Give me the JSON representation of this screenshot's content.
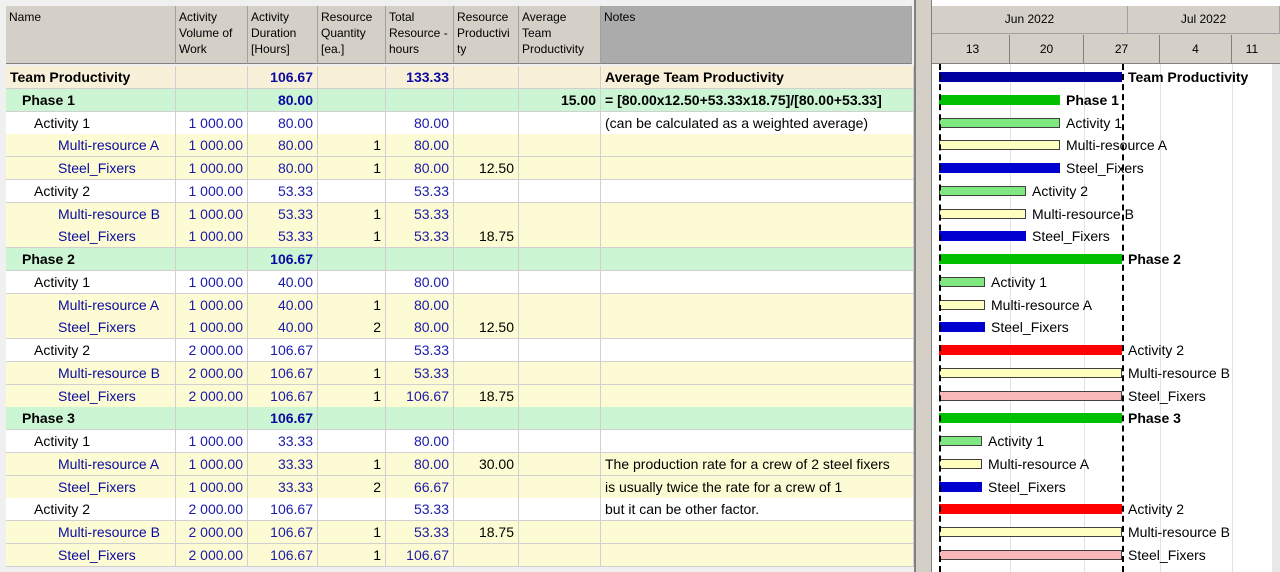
{
  "columns": {
    "name": "Name",
    "volume": "Activity Volume of Work",
    "duration": "Activity Duration [Hours]",
    "quantity": "Resource Quantity [ea.]",
    "total_hours": "Total Resource -hours",
    "productivity": "Resource Productivi ty",
    "avg_productivity": "Average Team Productivity",
    "notes": "Notes"
  },
  "rows": [
    {
      "type": "team",
      "name": "Team Productivity",
      "volume": "",
      "duration": "106.67",
      "quantity": "",
      "total": "133.33",
      "prod": "",
      "avg": "",
      "notes": "Average Team Productivity"
    },
    {
      "type": "phase",
      "name": "Phase 1",
      "volume": "",
      "duration": "80.00",
      "quantity": "",
      "total": "",
      "prod": "",
      "avg": "15.00",
      "notes": "= [80.00x12.50+53.33x18.75]/[80.00+53.33]"
    },
    {
      "type": "act",
      "name": "Activity 1",
      "volume": "1 000.00",
      "duration": "80.00",
      "quantity": "",
      "total": "80.00",
      "prod": "",
      "avg": "",
      "notes": "(can be calculated as a weighted average)"
    },
    {
      "type": "res",
      "name": "Multi-resource A",
      "volume": "1 000.00",
      "duration": "80.00",
      "quantity": "1",
      "total": "80.00",
      "prod": "",
      "avg": "",
      "notes": ""
    },
    {
      "type": "res",
      "name": "Steel_Fixers",
      "volume": "1 000.00",
      "duration": "80.00",
      "quantity": "1",
      "total": "80.00",
      "prod": "12.50",
      "avg": "",
      "notes": ""
    },
    {
      "type": "act",
      "name": "Activity 2",
      "volume": "1 000.00",
      "duration": "53.33",
      "quantity": "",
      "total": "53.33",
      "prod": "",
      "avg": "",
      "notes": ""
    },
    {
      "type": "res",
      "name": "Multi-resource B",
      "volume": "1 000.00",
      "duration": "53.33",
      "quantity": "1",
      "total": "53.33",
      "prod": "",
      "avg": "",
      "notes": ""
    },
    {
      "type": "res",
      "name": "Steel_Fixers",
      "volume": "1 000.00",
      "duration": "53.33",
      "quantity": "1",
      "total": "53.33",
      "prod": "18.75",
      "avg": "",
      "notes": ""
    },
    {
      "type": "phase",
      "name": "Phase 2",
      "volume": "",
      "duration": "106.67",
      "quantity": "",
      "total": "",
      "prod": "",
      "avg": "",
      "notes": ""
    },
    {
      "type": "act",
      "name": "Activity 1",
      "volume": "1 000.00",
      "duration": "40.00",
      "quantity": "",
      "total": "80.00",
      "prod": "",
      "avg": "",
      "notes": ""
    },
    {
      "type": "res",
      "name": "Multi-resource A",
      "volume": "1 000.00",
      "duration": "40.00",
      "quantity": "1",
      "total": "80.00",
      "prod": "",
      "avg": "",
      "notes": ""
    },
    {
      "type": "res",
      "name": "Steel_Fixers",
      "volume": "1 000.00",
      "duration": "40.00",
      "quantity": "2",
      "total": "80.00",
      "prod": "12.50",
      "avg": "",
      "notes": ""
    },
    {
      "type": "act",
      "name": "Activity 2",
      "volume": "2 000.00",
      "duration": "106.67",
      "quantity": "",
      "total": "53.33",
      "prod": "",
      "avg": "",
      "notes": ""
    },
    {
      "type": "res",
      "name": "Multi-resource B",
      "volume": "2 000.00",
      "duration": "106.67",
      "quantity": "1",
      "total": "53.33",
      "prod": "",
      "avg": "",
      "notes": ""
    },
    {
      "type": "res",
      "name": "Steel_Fixers",
      "volume": "2 000.00",
      "duration": "106.67",
      "quantity": "1",
      "total": "106.67",
      "prod": "18.75",
      "avg": "",
      "notes": ""
    },
    {
      "type": "phase",
      "name": "Phase 3",
      "volume": "",
      "duration": "106.67",
      "quantity": "",
      "total": "",
      "prod": "",
      "avg": "",
      "notes": ""
    },
    {
      "type": "act",
      "name": "Activity 1",
      "volume": "1 000.00",
      "duration": "33.33",
      "quantity": "",
      "total": "80.00",
      "prod": "",
      "avg": "",
      "notes": ""
    },
    {
      "type": "res",
      "name": "Multi-resource A",
      "volume": "1 000.00",
      "duration": "33.33",
      "quantity": "1",
      "total": "80.00",
      "prod": "30.00",
      "avg": "",
      "notes": "The production rate for a crew of 2 steel fixers"
    },
    {
      "type": "res",
      "name": "Steel_Fixers",
      "volume": "1 000.00",
      "duration": "33.33",
      "quantity": "2",
      "total": "66.67",
      "prod": "",
      "avg": "",
      "notes": "is usually twice the rate for a crew of 1"
    },
    {
      "type": "act",
      "name": "Activity 2",
      "volume": "2 000.00",
      "duration": "106.67",
      "quantity": "",
      "total": "53.33",
      "prod": "",
      "avg": "",
      "notes": "but it can be other factor."
    },
    {
      "type": "res",
      "name": "Multi-resource B",
      "volume": "2 000.00",
      "duration": "106.67",
      "quantity": "1",
      "total": "53.33",
      "prod": "18.75",
      "avg": "",
      "notes": ""
    },
    {
      "type": "res",
      "name": "Steel_Fixers",
      "volume": "2 000.00",
      "duration": "106.67",
      "quantity": "1",
      "total": "106.67",
      "prod": "",
      "avg": "",
      "notes": ""
    }
  ],
  "gantt": {
    "months": [
      "Jun 2022",
      "Jul 2022"
    ],
    "days": [
      "13",
      "20",
      "27",
      "4",
      "11"
    ],
    "bars": [
      {
        "label": "Team Productivity",
        "color": "#0000a0",
        "bold": true
      },
      {
        "label": "Phase 1",
        "color": "#00c000",
        "bold": true
      },
      {
        "label": "Activity 1",
        "color": "#80e880",
        "bold": false
      },
      {
        "label": "Multi-resource A",
        "color": "#ffffc0",
        "bold": false
      },
      {
        "label": "Steel_Fixers",
        "color": "#0000d0",
        "bold": false
      },
      {
        "label": "Activity 2",
        "color": "#80e880",
        "bold": false
      },
      {
        "label": "Multi-resource B",
        "color": "#ffffc0",
        "bold": false
      },
      {
        "label": "Steel_Fixers",
        "color": "#0000d0",
        "bold": false
      },
      {
        "label": "Phase 2",
        "color": "#00c000",
        "bold": true
      },
      {
        "label": "Activity 1",
        "color": "#80e880",
        "bold": false
      },
      {
        "label": "Multi-resource A",
        "color": "#ffffc0",
        "bold": false
      },
      {
        "label": "Steel_Fixers",
        "color": "#0000d0",
        "bold": false
      },
      {
        "label": "Activity 2",
        "color": "#ff0000",
        "bold": false
      },
      {
        "label": "Multi-resource B",
        "color": "#ffffc0",
        "bold": false
      },
      {
        "label": "Steel_Fixers",
        "color": "#f8b8b8",
        "bold": false
      },
      {
        "label": "Phase 3",
        "color": "#00c000",
        "bold": true
      },
      {
        "label": "Activity 1",
        "color": "#80e880",
        "bold": false
      },
      {
        "label": "Multi-resource A",
        "color": "#ffffc0",
        "bold": false
      },
      {
        "label": "Steel_Fixers",
        "color": "#0000d0",
        "bold": false
      },
      {
        "label": "Activity 2",
        "color": "#ff0000",
        "bold": false
      },
      {
        "label": "Multi-resource B",
        "color": "#ffffc0",
        "bold": false
      },
      {
        "label": "Steel_Fixers",
        "color": "#f8b8b8",
        "bold": false
      }
    ]
  }
}
